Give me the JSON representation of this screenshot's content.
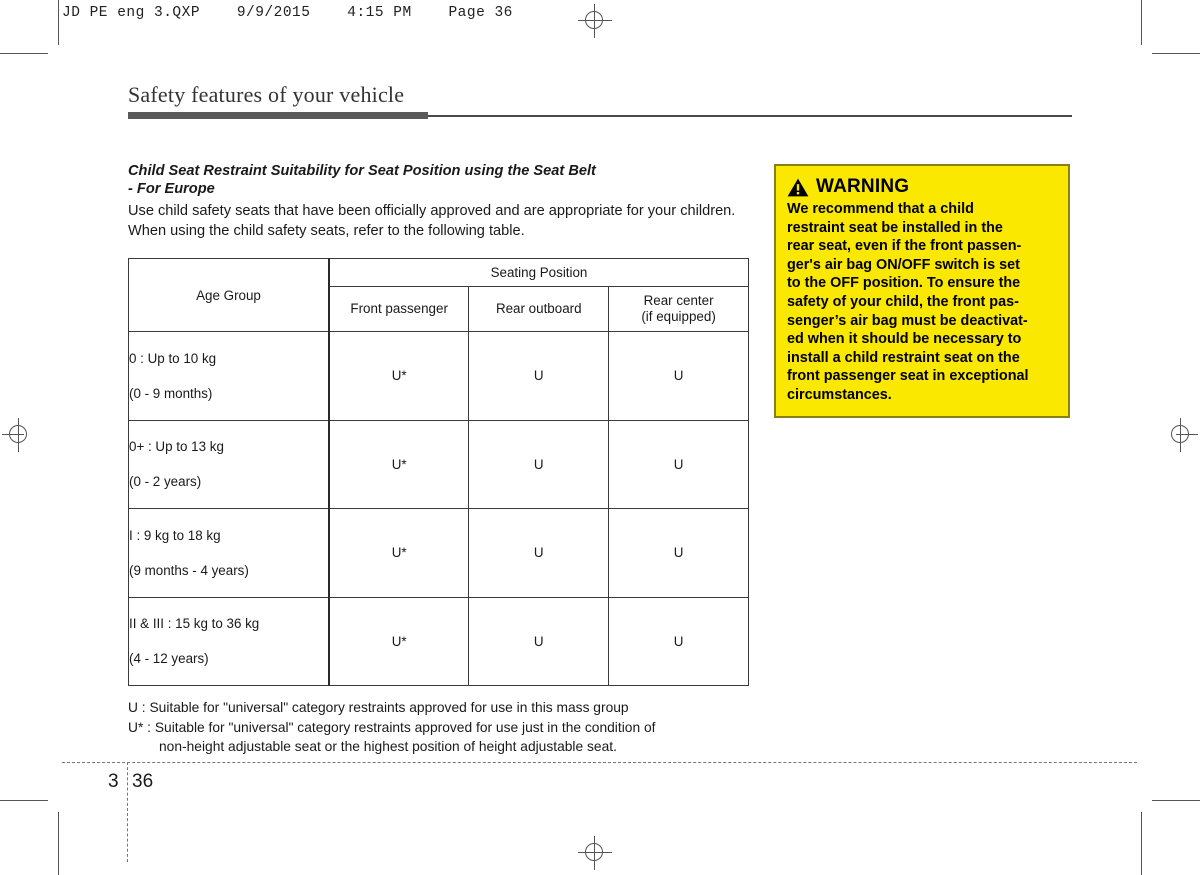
{
  "print_header": {
    "text": "JD PE eng 3.QXP    9/9/2015    4:15 PM    Page 36"
  },
  "chapter": {
    "title": "Safety features of your vehicle"
  },
  "section": {
    "heading_line1": "Child Seat Restraint Suitability for Seat Position using the Seat Belt",
    "heading_line2": "- For Europe",
    "intro": "Use child safety seats that have been officially approved and are appropriate for your children. When using the child safety seats, refer to the following table."
  },
  "table": {
    "header_age_group": "Age Group",
    "header_seating_position": "Seating Position",
    "columns": [
      {
        "line1": "Front  passenger",
        "line2": ""
      },
      {
        "line1": "Rear outboard",
        "line2": ""
      },
      {
        "line1": "Rear center",
        "line2": "(if equipped)"
      }
    ],
    "rows": [
      {
        "age_line1": "0   : Up to 10 kg",
        "age_line2": "(0 - 9 months)",
        "front_passenger": "U*",
        "rear_outboard": "U",
        "rear_center": "U"
      },
      {
        "age_line1": "0+ : Up to 13 kg",
        "age_line2": "(0 - 2 years)",
        "front_passenger": "U*",
        "rear_outboard": "U",
        "rear_center": "U"
      },
      {
        "age_line1": "I    : 9 kg to 18 kg",
        "age_line2": "(9 months - 4 years)",
        "front_passenger": "U*",
        "rear_outboard": "U",
        "rear_center": "U"
      },
      {
        "age_line1": "II & III : 15 kg to 36 kg",
        "age_line2": "(4 - 12 years)",
        "front_passenger": "U*",
        "rear_outboard": "U",
        "rear_center": "U"
      }
    ]
  },
  "legend": {
    "line_u": "U : Suitable for \"universal\" category restraints approved for use in this mass group",
    "line_ustar": "U* : Suitable for \"universal\" category restraints approved for use just in the condition of",
    "line_ustar_cont": "non-height adjustable seat or the highest position of height adjustable seat."
  },
  "warning": {
    "label": "WARNING",
    "icon": "warning-triangle-icon",
    "line1": "We recommend that a child",
    "line2": "restraint  seat be installed in the",
    "line3": "rear seat, even if the front passen-",
    "line4": "ger's air bag ON/OFF switch is set",
    "line5": "to the OFF position. To ensure the",
    "line6": "safety of your child, the front pas-",
    "line7": "senger’s air bag must be deactivat-",
    "line8": "ed when it should be necessary to",
    "line9": "install a child restraint seat on the",
    "line10": "front passenger seat in exceptional",
    "line11": "circumstances.",
    "background_color": "#FBE800",
    "border_color": "#8A7F15"
  },
  "footer": {
    "chapter_number": "3",
    "page_number": "36"
  }
}
